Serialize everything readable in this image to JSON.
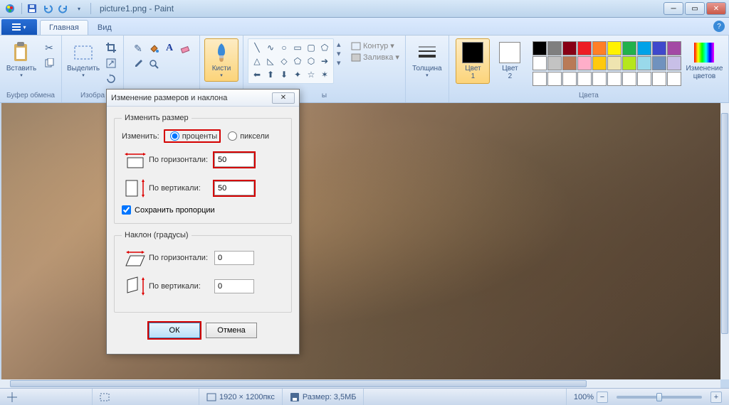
{
  "title_bar": {
    "app_title": "picture1.png - Paint"
  },
  "tabs": {
    "file_caret": "▾",
    "home": "Главная",
    "view": "Вид"
  },
  "ribbon": {
    "clipboard": {
      "paste": "Вставить",
      "label": "Буфер обмена"
    },
    "image": {
      "select": "Выделить",
      "label": "Изобра"
    },
    "tools": {
      "label": " "
    },
    "brushes": {
      "btn": "Кисти"
    },
    "shapes": {
      "outline": "Контур",
      "fill": "Заливка",
      "label": "ы"
    },
    "size": {
      "btn": "Толщина"
    },
    "colors": {
      "c1": "Цвет\n1",
      "c2": "Цвет\n2",
      "edit": "Изменение\nцветов",
      "label": "Цвета"
    },
    "palette": [
      "#000000",
      "#7f7f7f",
      "#880015",
      "#ed1c24",
      "#ff7f27",
      "#fff200",
      "#22b14c",
      "#00a2e8",
      "#3f48cc",
      "#a349a4",
      "#ffffff",
      "#c3c3c3",
      "#b97a57",
      "#ffaec9",
      "#ffc90e",
      "#efe4b0",
      "#b5e61d",
      "#99d9ea",
      "#7092be",
      "#c8bfe7"
    ]
  },
  "dialog": {
    "title": "Изменение размеров и наклона",
    "resize_legend": "Изменить размер",
    "by_label": "Изменить:",
    "percent": "проценты",
    "pixels": "пиксели",
    "horiz": "По горизонтали:",
    "vert": "По вертикали:",
    "h_val": "50",
    "v_val": "50",
    "keep_aspect": "Сохранить пропорции",
    "skew_legend": "Наклон (градусы)",
    "skew_h": "0",
    "skew_v": "0",
    "ok": "ОК",
    "cancel": "Отмена"
  },
  "status": {
    "dims": "1920 × 1200пкс",
    "size": "Размер: 3,5МБ",
    "zoom": "100%"
  }
}
